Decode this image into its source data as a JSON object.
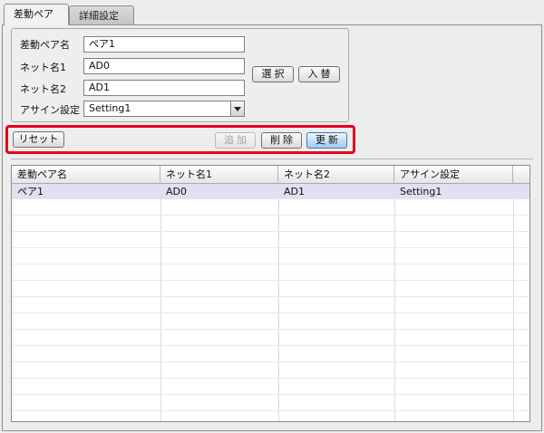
{
  "tabs": [
    {
      "label": "差動ペア",
      "active": true
    },
    {
      "label": "詳細設定",
      "active": false
    }
  ],
  "form": {
    "pair_name_label": "差動ペア名",
    "pair_name_value": "ペア1",
    "net1_label": "ネット名1",
    "net1_value": "AD0",
    "net2_label": "ネット名2",
    "net2_value": "AD1",
    "assign_label": "アサイン設定",
    "assign_value": "Setting1"
  },
  "buttons": {
    "select": "選 択",
    "swap": "入 替",
    "reset": "リセット",
    "add": "追 加",
    "delete": "削 除",
    "update": "更 新"
  },
  "table": {
    "columns": [
      "差動ペア名",
      "ネット名1",
      "ネット名2",
      "アサイン設定"
    ],
    "rows": [
      [
        "ペア1",
        "AD0",
        "AD1",
        "Setting1"
      ]
    ]
  },
  "colors": {
    "highlight": "#e3001b",
    "selected_row": "#dfe1f2"
  }
}
